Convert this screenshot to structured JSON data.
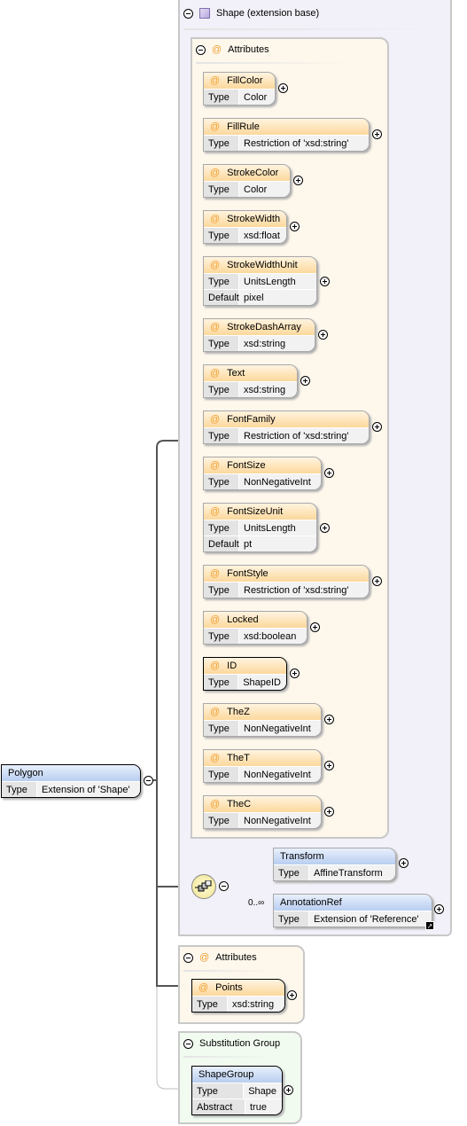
{
  "shape_group": {
    "title": "Shape (extension base)"
  },
  "attributes_group": {
    "title": "Attributes"
  },
  "attributes": [
    {
      "name": "FillColor",
      "rows": [
        [
          "Type",
          "Color"
        ]
      ]
    },
    {
      "name": "FillRule",
      "rows": [
        [
          "Type",
          "Restriction of 'xsd:string'"
        ]
      ]
    },
    {
      "name": "StrokeColor",
      "rows": [
        [
          "Type",
          "Color"
        ]
      ]
    },
    {
      "name": "StrokeWidth",
      "rows": [
        [
          "Type",
          "xsd:float"
        ]
      ]
    },
    {
      "name": "StrokeWidthUnit",
      "rows": [
        [
          "Type",
          "UnitsLength"
        ],
        [
          "Default",
          "pixel"
        ]
      ]
    },
    {
      "name": "StrokeDashArray",
      "rows": [
        [
          "Type",
          "xsd:string"
        ]
      ]
    },
    {
      "name": "Text",
      "rows": [
        [
          "Type",
          "xsd:string"
        ]
      ]
    },
    {
      "name": "FontFamily",
      "rows": [
        [
          "Type",
          "Restriction of 'xsd:string'"
        ]
      ]
    },
    {
      "name": "FontSize",
      "rows": [
        [
          "Type",
          "NonNegativeInt"
        ]
      ]
    },
    {
      "name": "FontSizeUnit",
      "rows": [
        [
          "Type",
          "UnitsLength"
        ],
        [
          "Default",
          "pt"
        ]
      ]
    },
    {
      "name": "FontStyle",
      "rows": [
        [
          "Type",
          "Restriction of 'xsd:string'"
        ]
      ]
    },
    {
      "name": "Locked",
      "rows": [
        [
          "Type",
          "xsd:boolean"
        ]
      ]
    },
    {
      "name": "ID",
      "required": true,
      "rows": [
        [
          "Type",
          "ShapeID"
        ]
      ]
    },
    {
      "name": "TheZ",
      "rows": [
        [
          "Type",
          "NonNegativeInt"
        ]
      ]
    },
    {
      "name": "TheT",
      "rows": [
        [
          "Type",
          "NonNegativeInt"
        ]
      ]
    },
    {
      "name": "TheC",
      "rows": [
        [
          "Type",
          "NonNegativeInt"
        ]
      ]
    }
  ],
  "sequence": {
    "icon": "sequence-icon",
    "elements": [
      {
        "name": "Transform",
        "type_label": "Type",
        "type": "AffineTransform"
      },
      {
        "name": "AnnotationRef",
        "type_label": "Type",
        "type": "Extension of 'Reference'",
        "cardinality": "0..∞"
      }
    ]
  },
  "polygon": {
    "name": "Polygon",
    "type_label": "Type",
    "type": "Extension of 'Shape'"
  },
  "own_attributes": {
    "title": "Attributes",
    "points": {
      "name": "Points",
      "type_label": "Type",
      "type": "xsd:string"
    }
  },
  "substitution": {
    "title": "Substitution Group",
    "element": {
      "name": "ShapeGroup",
      "rows": [
        [
          "Type",
          "Shape"
        ],
        [
          "Abstract",
          "true"
        ]
      ]
    }
  },
  "colors": {
    "attribute_header": "#fcd89c",
    "element_header": "#b8cef0",
    "shape_bg": "#f2f0f8",
    "attributes_bg": "#fdf7ec",
    "substitution_bg": "#f1fbf0"
  }
}
